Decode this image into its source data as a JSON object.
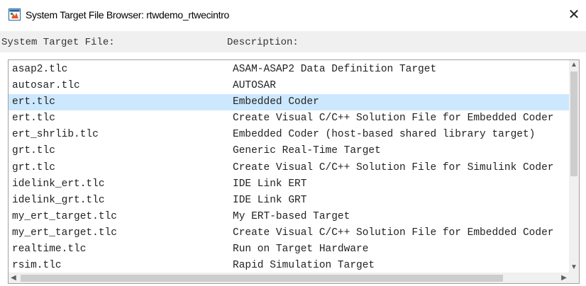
{
  "window": {
    "title": "System Target File Browser: rtwdemo_rtwecintro",
    "close_glyph": "✕",
    "icon": "simulink-app-icon"
  },
  "header": {
    "file_col": "System Target File:",
    "desc_col": "Description:"
  },
  "selected_index": 2,
  "colors": {
    "selection": "#cce8ff"
  },
  "rows": [
    {
      "file": "asap2.tlc",
      "desc": "ASAM-ASAP2 Data Definition Target"
    },
    {
      "file": "autosar.tlc",
      "desc": "AUTOSAR"
    },
    {
      "file": "ert.tlc",
      "desc": "Embedded Coder"
    },
    {
      "file": "ert.tlc",
      "desc": "Create Visual C/C++ Solution File for Embedded Coder"
    },
    {
      "file": "ert_shrlib.tlc",
      "desc": "Embedded Coder (host-based shared library target)"
    },
    {
      "file": "grt.tlc",
      "desc": "Generic Real-Time Target"
    },
    {
      "file": "grt.tlc",
      "desc": "Create Visual C/C++ Solution File for Simulink Coder"
    },
    {
      "file": "idelink_ert.tlc",
      "desc": "IDE Link ERT"
    },
    {
      "file": "idelink_grt.tlc",
      "desc": "IDE Link GRT"
    },
    {
      "file": "my_ert_target.tlc",
      "desc": "My ERT-based Target"
    },
    {
      "file": "my_ert_target.tlc",
      "desc": "Create Visual C/C++ Solution File for Embedded Coder"
    },
    {
      "file": "realtime.tlc",
      "desc": "Run on Target Hardware"
    },
    {
      "file": "rsim.tlc",
      "desc": "Rapid Simulation Target"
    }
  ],
  "scroll": {
    "up": "▲",
    "down": "▼",
    "left": "◀",
    "right": "▶"
  }
}
